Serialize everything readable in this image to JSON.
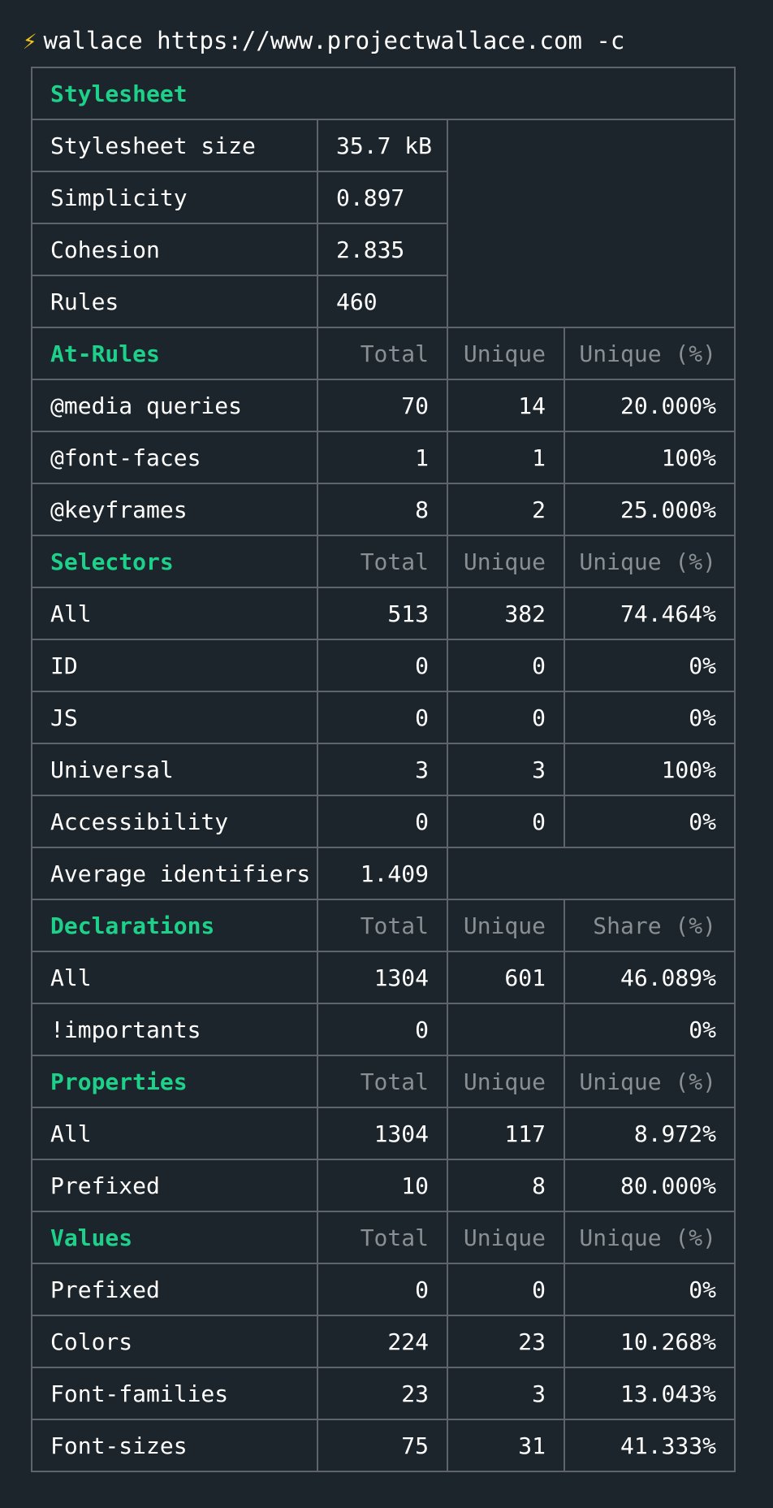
{
  "prompt": {
    "icon": "lightning-icon",
    "icon_glyph": "⚡",
    "command": "wallace https://www.projectwallace.com -c"
  },
  "colors": {
    "background": "#1c252b",
    "border": "#5e6469",
    "section": "#1ed18a",
    "header": "#8a8f93",
    "text": "#ffffff",
    "icon": "#f5c518"
  },
  "stylesheet": {
    "title": "Stylesheet",
    "rows": [
      {
        "label": "Stylesheet size",
        "value": "35.7 kB"
      },
      {
        "label": "Simplicity",
        "value": "0.897"
      },
      {
        "label": "Cohesion",
        "value": "2.835"
      },
      {
        "label": "Rules",
        "value": "460"
      }
    ]
  },
  "sections": [
    {
      "title": "At-Rules",
      "headers": [
        "Total",
        "Unique",
        "Unique (%)"
      ],
      "rows": [
        {
          "label": "@media queries",
          "total": "70",
          "unique": "14",
          "pct": "20.000%"
        },
        {
          "label": "@font-faces",
          "total": "1",
          "unique": "1",
          "pct": "100%"
        },
        {
          "label": "@keyframes",
          "total": "8",
          "unique": "2",
          "pct": "25.000%"
        }
      ]
    },
    {
      "title": "Selectors",
      "headers": [
        "Total",
        "Unique",
        "Unique (%)"
      ],
      "rows": [
        {
          "label": "All",
          "total": "513",
          "unique": "382",
          "pct": "74.464%"
        },
        {
          "label": "ID",
          "total": "0",
          "unique": "0",
          "pct": "0%"
        },
        {
          "label": "JS",
          "total": "0",
          "unique": "0",
          "pct": "0%"
        },
        {
          "label": "Universal",
          "total": "3",
          "unique": "3",
          "pct": "100%"
        },
        {
          "label": "Accessibility",
          "total": "0",
          "unique": "0",
          "pct": "0%"
        },
        {
          "label": "Average identifiers",
          "total": "1.409",
          "unique": null,
          "pct": null,
          "span": "value-wide"
        }
      ]
    },
    {
      "title": "Declarations",
      "headers": [
        "Total",
        "Unique",
        "Share (%)"
      ],
      "rows": [
        {
          "label": "All",
          "total": "1304",
          "unique": "601",
          "pct": "46.089%"
        },
        {
          "label": "!importants",
          "total": "0",
          "unique": "",
          "pct": "0%"
        }
      ]
    },
    {
      "title": "Properties",
      "headers": [
        "Total",
        "Unique",
        "Unique (%)"
      ],
      "rows": [
        {
          "label": "All",
          "total": "1304",
          "unique": "117",
          "pct": "8.972%"
        },
        {
          "label": "Prefixed",
          "total": "10",
          "unique": "8",
          "pct": "80.000%"
        }
      ]
    },
    {
      "title": "Values",
      "headers": [
        "Total",
        "Unique",
        "Unique (%)"
      ],
      "rows": [
        {
          "label": "Prefixed",
          "total": "0",
          "unique": "0",
          "pct": "0%"
        },
        {
          "label": "Colors",
          "total": "224",
          "unique": "23",
          "pct": "10.268%"
        },
        {
          "label": "Font-families",
          "total": "23",
          "unique": "3",
          "pct": "13.043%"
        },
        {
          "label": "Font-sizes",
          "total": "75",
          "unique": "31",
          "pct": "41.333%"
        }
      ]
    }
  ]
}
